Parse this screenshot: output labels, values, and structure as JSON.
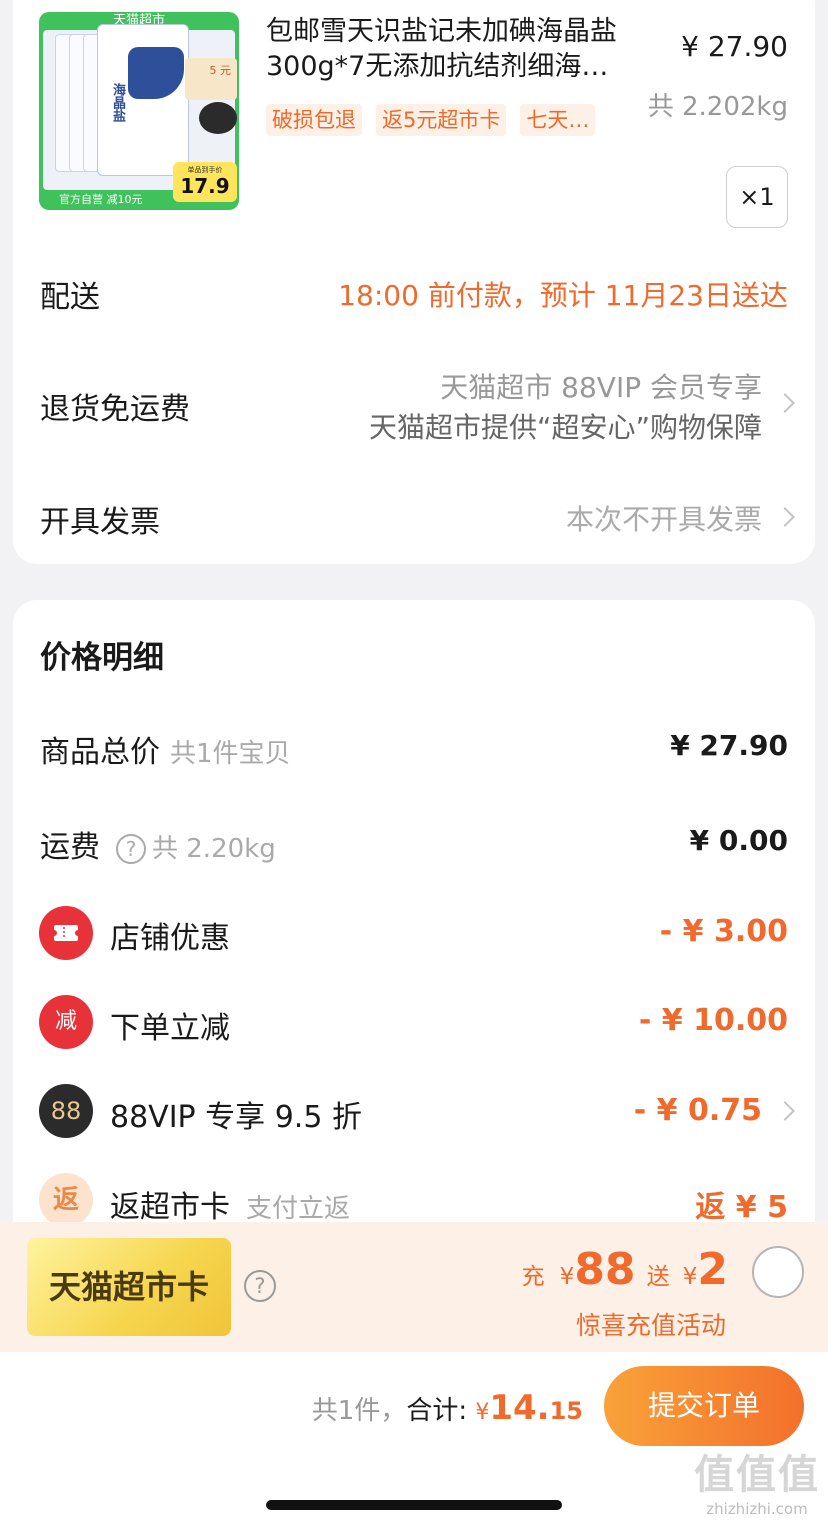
{
  "product": {
    "image_store_label": "天猫超市",
    "image_label_5": "5 元",
    "image_salt_text": "海晶盐",
    "image_price_small": "单品到手价",
    "image_price": "17.9",
    "image_bottom_text": "官方自营 减10元",
    "title": "包邮雪天识盐记未加碘海晶盐300g*7无添加抗结剂细海…",
    "price": "¥ 27.90",
    "weight": "共 2.202kg",
    "tags": [
      "破损包退",
      "返5元超市卡",
      "七天…"
    ],
    "quantity": "×1"
  },
  "delivery": {
    "label": "配送",
    "value": "18:00 前付款，预计 11月23日送达"
  },
  "return_shipping": {
    "label": "退货免运费",
    "line1": "天猫超市 88VIP 会员专享",
    "line2": "天猫超市提供“超安心”购物保障"
  },
  "invoice": {
    "label": "开具发票",
    "value": "本次不开具发票"
  },
  "price_detail": {
    "title": "价格明细",
    "goods_total_label": "商品总价",
    "goods_total_sub": "共1件宝贝",
    "goods_total_value": "¥ 27.90",
    "shipping_label": "运费",
    "shipping_help": "?",
    "shipping_sub": "共 2.20kg",
    "shipping_value": "¥ 0.00",
    "discounts": [
      {
        "icon": "ticket-icon",
        "icon_text": "",
        "label": "店铺优惠",
        "sub": "",
        "value": "- ¥ 3.00"
      },
      {
        "icon": "jian-icon",
        "icon_text": "减",
        "label": "下单立减",
        "sub": "",
        "value": "- ¥ 10.00"
      },
      {
        "icon": "vip88-icon",
        "icon_text": "88",
        "label": "88VIP 专享 9.5 折",
        "sub": "",
        "value": "- ¥ 0.75"
      },
      {
        "icon": "fan-icon",
        "icon_text": "返",
        "label": "返超市卡",
        "sub": "支付立返",
        "value": "返 ¥ 5"
      }
    ]
  },
  "promo": {
    "card_label": "天猫超市卡",
    "help": "?",
    "chong": "充",
    "currency": "¥",
    "charge_amount": "88",
    "song": "送",
    "gift_amount": "2",
    "subtitle": "惊喜充值活动"
  },
  "footer": {
    "count_text": "共1件，",
    "total_label": "合计:",
    "currency": "¥",
    "total_int": "14.",
    "total_dec": "15",
    "submit_label": "提交订单"
  },
  "watermark": {
    "title": "值值值",
    "url": "zhizhizhi.com"
  },
  "colors": {
    "accent": "#ef6a2c",
    "submit_start": "#f9a23a",
    "submit_end": "#f3702b",
    "promo_bg": "#fdf0e6"
  }
}
